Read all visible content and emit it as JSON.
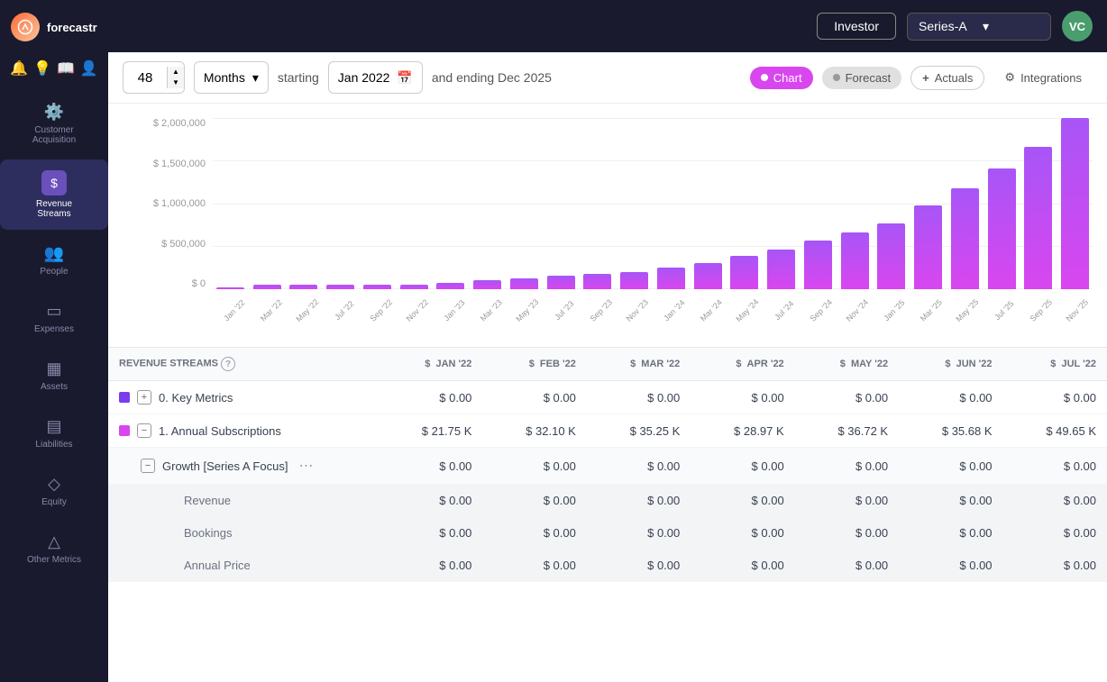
{
  "app": {
    "logo_text": "forecastr",
    "investor_label": "Investor",
    "series_label": "Series-A",
    "avatar_text": "VC"
  },
  "sidebar": {
    "items": [
      {
        "id": "customer-acquisition",
        "label": "Customer Acquisition",
        "icon": "⚙"
      },
      {
        "id": "revenue-streams",
        "label": "Revenue Streams",
        "icon": "$",
        "active": true
      },
      {
        "id": "people",
        "label": "People",
        "icon": "👥"
      },
      {
        "id": "expenses",
        "label": "Expenses",
        "icon": "▭"
      },
      {
        "id": "assets",
        "label": "Assets",
        "icon": "▦"
      },
      {
        "id": "liabilities",
        "label": "Liabilities",
        "icon": "▤"
      },
      {
        "id": "equity",
        "label": "Equity",
        "icon": "◇"
      },
      {
        "id": "other-metrics",
        "label": "Other Metrics",
        "icon": "△"
      }
    ]
  },
  "toolbar": {
    "period_value": "48",
    "period_type": "Months",
    "starting_label": "starting",
    "start_date": "Jan 2022",
    "ending_label": "and ending Dec 2025",
    "chart_label": "Chart",
    "forecast_label": "Forecast",
    "actuals_label": "Actuals",
    "integrations_label": "Integrations"
  },
  "chart": {
    "y_labels": [
      "$ 2,000,000",
      "$ 1,500,000",
      "$ 1,000,000",
      "$ 500,000",
      "$ 0"
    ],
    "x_labels": [
      "Jan '22",
      "Mar '22",
      "May '22",
      "Jul '22",
      "Sep '22",
      "Nov '22",
      "Jan '23",
      "Mar '23",
      "May '23",
      "Jul '23",
      "Sep '23",
      "Nov '23",
      "Jan '24",
      "Mar '24",
      "May '24",
      "Jul '24",
      "Sep '24",
      "Nov '24",
      "Jan '25",
      "Mar '25",
      "May '25",
      "Jul '25",
      "Sep '25",
      "Nov '25"
    ],
    "bars": [
      1,
      2,
      2,
      2,
      2,
      2,
      3,
      4,
      5,
      6,
      7,
      8,
      10,
      12,
      15,
      18,
      22,
      26,
      30,
      38,
      46,
      55,
      65,
      78
    ]
  },
  "table": {
    "header": {
      "row_label": "REVENUE STREAMS",
      "columns": [
        "JAN '22",
        "FEB '22",
        "MAR '22",
        "APR '22",
        "MAY '22",
        "JUN '22",
        "JUL '22"
      ]
    },
    "rows": [
      {
        "id": "key-metrics",
        "type": "group",
        "color": "purple",
        "expand": true,
        "label": "0. Key Metrics",
        "values": [
          "0.00",
          "0.00",
          "0.00",
          "0.00",
          "0.00",
          "0.00",
          "0.00"
        ]
      },
      {
        "id": "annual-subscriptions",
        "type": "group",
        "color": "pink",
        "expand": false,
        "label": "1. Annual Subscriptions",
        "values": [
          "21.75 K",
          "32.10 K",
          "35.25 K",
          "28.97 K",
          "36.72 K",
          "35.68 K",
          "49.65 K"
        ]
      },
      {
        "id": "growth-series-a",
        "type": "sub",
        "label": "Growth [Series A Focus]",
        "values": [
          "0.00",
          "0.00",
          "0.00",
          "0.00",
          "0.00",
          "0.00",
          "0.00"
        ],
        "has_more": true
      },
      {
        "id": "revenue",
        "type": "indent",
        "label": "Revenue",
        "values": [
          "0.00",
          "0.00",
          "0.00",
          "0.00",
          "0.00",
          "0.00",
          "0.00"
        ]
      },
      {
        "id": "bookings",
        "type": "indent",
        "label": "Bookings",
        "values": [
          "0.00",
          "0.00",
          "0.00",
          "0.00",
          "0.00",
          "0.00",
          "0.00"
        ]
      },
      {
        "id": "annual-price",
        "type": "indent",
        "label": "Annual Price",
        "values": [
          "0.00",
          "0.00",
          "0.00",
          "0.00",
          "0.00",
          "0.00",
          "0.00"
        ]
      }
    ]
  }
}
